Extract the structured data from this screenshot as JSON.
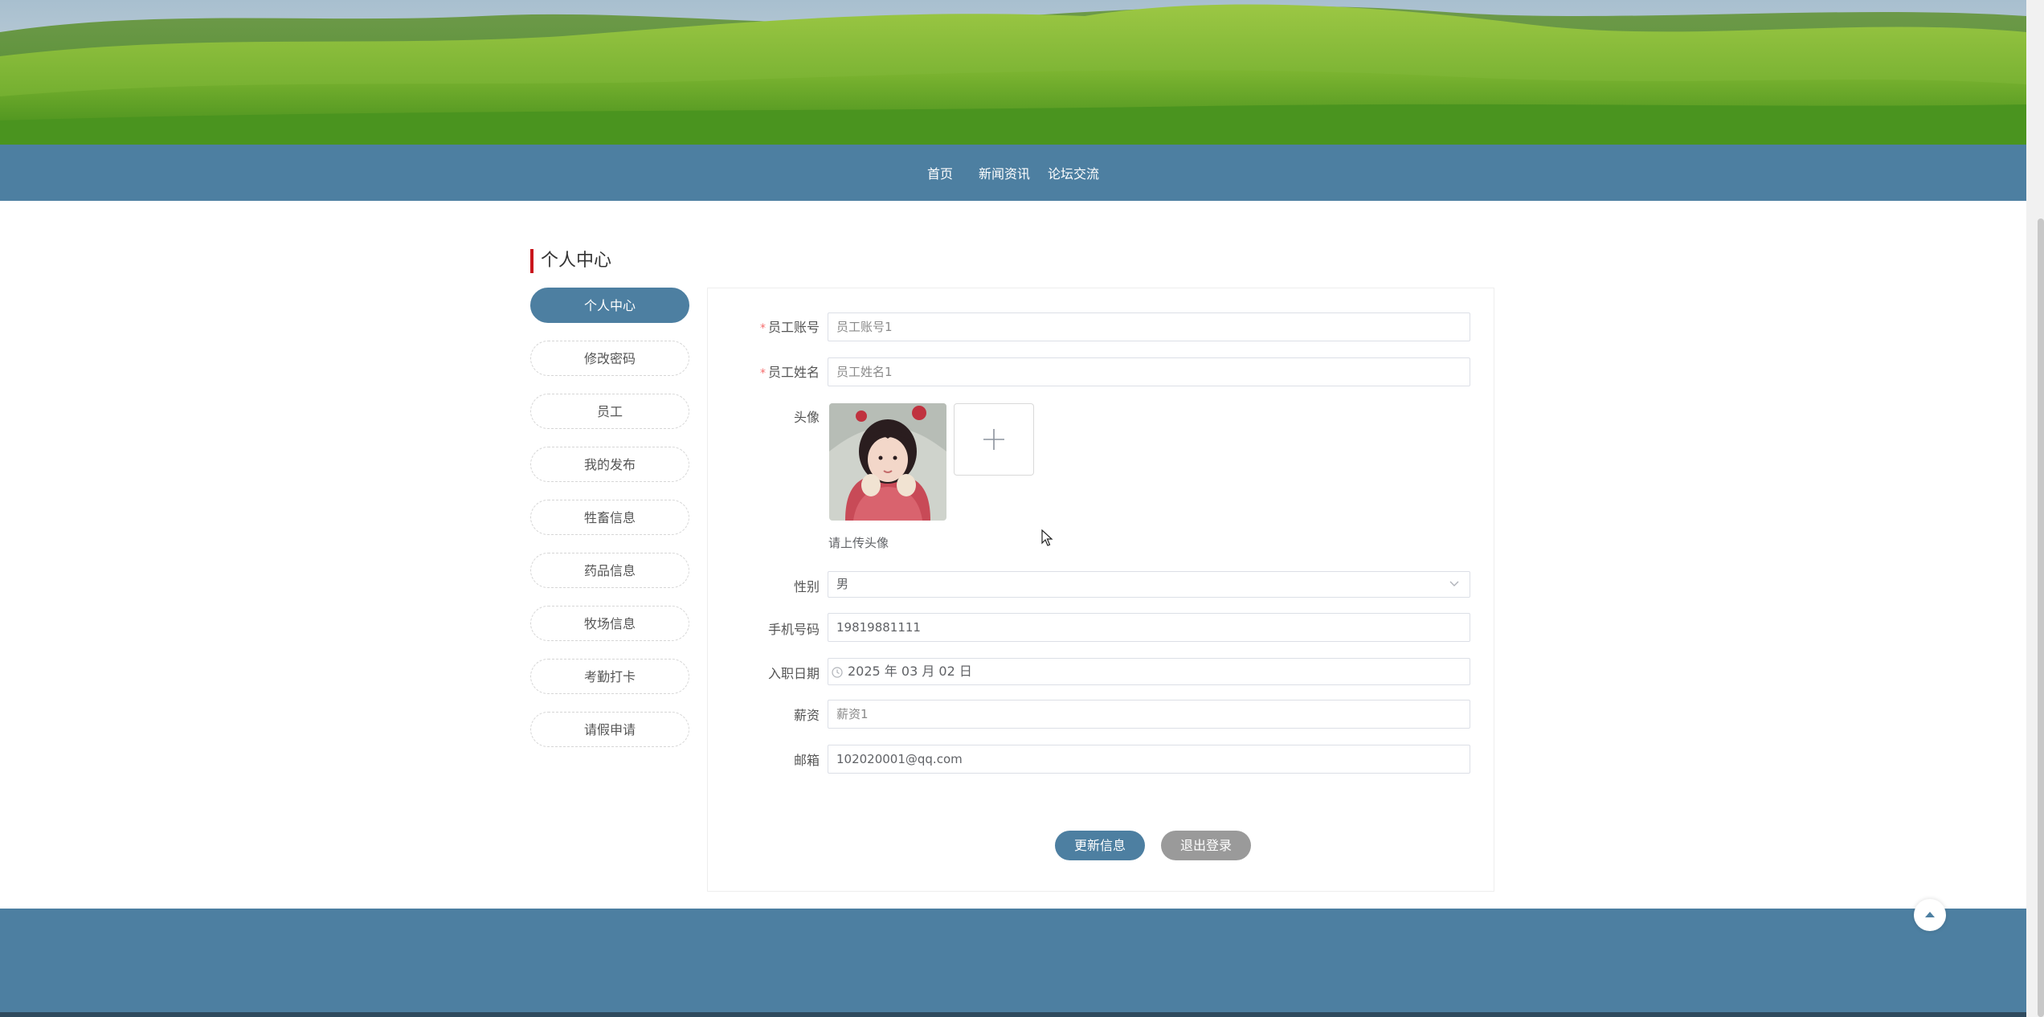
{
  "nav": {
    "items": [
      "首页",
      "新闻资讯",
      "论坛交流"
    ]
  },
  "section_title": "个人中心",
  "sidebar": {
    "items": [
      {
        "label": "个人中心",
        "active": true
      },
      {
        "label": "修改密码"
      },
      {
        "label": "员工"
      },
      {
        "label": "我的发布"
      },
      {
        "label": "牲畜信息"
      },
      {
        "label": "药品信息"
      },
      {
        "label": "牧场信息"
      },
      {
        "label": "考勤打卡"
      },
      {
        "label": "请假申请"
      }
    ]
  },
  "form": {
    "account": {
      "label": "员工账号",
      "required": true,
      "value": "",
      "placeholder": "员工账号1"
    },
    "name": {
      "label": "员工姓名",
      "required": true,
      "value": "",
      "placeholder": "员工姓名1"
    },
    "avatar": {
      "label": "头像",
      "tip": "请上传头像",
      "upload_icon": "plus-icon"
    },
    "gender": {
      "label": "性别",
      "value": "男"
    },
    "phone": {
      "label": "手机号码",
      "value": "19819881111"
    },
    "hire_date": {
      "label": "入职日期",
      "value": "2025 年 03 月 02 日"
    },
    "salary": {
      "label": "薪资",
      "value": "",
      "placeholder": "薪资1"
    },
    "email": {
      "label": "邮箱",
      "value": "102020001@qq.com"
    }
  },
  "buttons": {
    "update": "更新信息",
    "logout": "退出登录"
  },
  "colors": {
    "primary": "#4d7fa1",
    "accent_bar": "#c9161d",
    "logout": "#9a9a9a",
    "required": "#f56c6c"
  }
}
